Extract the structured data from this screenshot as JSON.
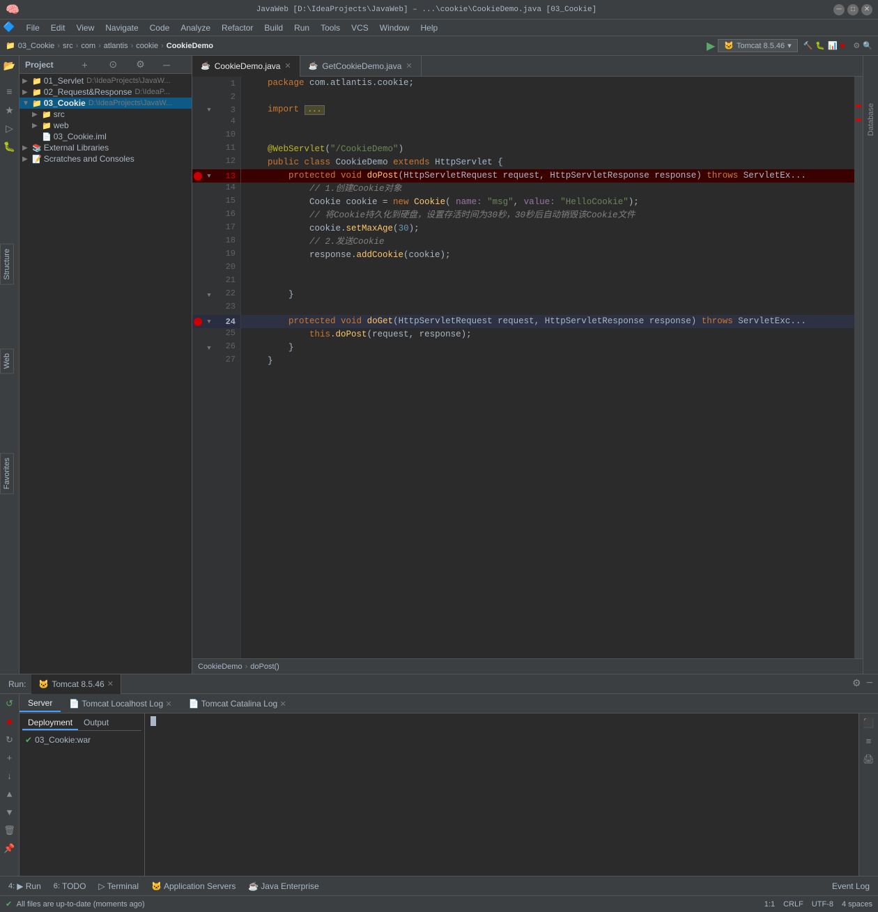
{
  "window": {
    "title": "JavaWeb [D:\\IdeaProjects\\JavaWeb] – ...\\cookie\\CookieDemo.java [03_Cookie]",
    "os_icon": "intellij-icon"
  },
  "menu": {
    "items": [
      "File",
      "Edit",
      "View",
      "Navigate",
      "Code",
      "Analyze",
      "Refactor",
      "Build",
      "Run",
      "Tools",
      "VCS",
      "Window",
      "Help"
    ]
  },
  "breadcrumb": {
    "items": [
      "03_Cookie",
      "src",
      "com",
      "atlantis",
      "cookie",
      "CookieDemo"
    ],
    "run_config": "Tomcat 8.5.46"
  },
  "project": {
    "label": "Project",
    "items": [
      {
        "indent": 0,
        "type": "folder",
        "name": "01_Servlet",
        "path": "D:\\IdeaProjects\\JavaW...",
        "expanded": true
      },
      {
        "indent": 0,
        "type": "folder",
        "name": "02_Request&Response",
        "path": "D:\\IdeaP...",
        "expanded": false
      },
      {
        "indent": 0,
        "type": "folder",
        "name": "03_Cookie",
        "path": "D:\\IdeaProjects\\JavaW...",
        "expanded": true,
        "selected": true
      },
      {
        "indent": 1,
        "type": "folder",
        "name": "src",
        "expanded": true
      },
      {
        "indent": 1,
        "type": "folder",
        "name": "web",
        "expanded": false
      },
      {
        "indent": 1,
        "type": "xml",
        "name": "03_Cookie.iml",
        "expanded": false
      },
      {
        "indent": 0,
        "type": "lib",
        "name": "External Libraries",
        "expanded": false
      },
      {
        "indent": 0,
        "type": "scratch",
        "name": "Scratches and Consoles",
        "expanded": false
      }
    ]
  },
  "tabs": [
    {
      "label": "CookieDemo.java",
      "active": true
    },
    {
      "label": "GetCookieDemo.java",
      "active": false
    }
  ],
  "code": {
    "lines": [
      {
        "num": 1,
        "content": "    package com.atlantis.cookie;",
        "type": "package"
      },
      {
        "num": 2,
        "content": ""
      },
      {
        "num": 3,
        "content": "    import ...",
        "type": "import",
        "has_fold": true
      },
      {
        "num": 4,
        "content": ""
      },
      {
        "num": 10,
        "content": ""
      },
      {
        "num": 11,
        "content": "    @WebServlet(\"/CookieDemo\")",
        "type": "annotation"
      },
      {
        "num": 12,
        "content": "    public class CookieDemo extends HttpServlet {",
        "type": "class"
      },
      {
        "num": 13,
        "content": "        protected void doPost(HttpServletRequest request, HttpServletResponse response) throws ServletEx...",
        "type": "method",
        "has_bp": true,
        "has_fold": true
      },
      {
        "num": 14,
        "content": "            // 1.创建Cookie对象",
        "type": "comment"
      },
      {
        "num": 15,
        "content": "            Cookie cookie = new Cookie( name: \"msg\", value: \"HelloCookie\");",
        "type": "code"
      },
      {
        "num": 16,
        "content": "            // 将Cookie持久化到硬盘，设置存活时间为30秒，30秒后自动销毁该Cookie文件",
        "type": "comment"
      },
      {
        "num": 17,
        "content": "            cookie.setMaxAge(30);",
        "type": "code"
      },
      {
        "num": 18,
        "content": "            // 2.发送Cookie",
        "type": "comment"
      },
      {
        "num": 19,
        "content": "            response.addCookie(cookie);",
        "type": "code"
      },
      {
        "num": 20,
        "content": ""
      },
      {
        "num": 21,
        "content": ""
      },
      {
        "num": 22,
        "content": "        }",
        "has_fold": true
      },
      {
        "num": 23,
        "content": ""
      },
      {
        "num": 24,
        "content": "        protected void doGet(HttpServletRequest request, HttpServletResponse response) throws ServletExc...",
        "type": "method",
        "has_bp": true,
        "has_fold": true,
        "is_active": true
      },
      {
        "num": 25,
        "content": "            this.doPost(request, response);",
        "type": "code"
      },
      {
        "num": 26,
        "content": "        }",
        "has_fold": true
      },
      {
        "num": 27,
        "content": "    }"
      }
    ]
  },
  "bottom_breadcrumb": {
    "items": [
      "CookieDemo",
      "doPost()"
    ]
  },
  "run_panel": {
    "label": "Run:",
    "config_name": "Tomcat 8.5.46",
    "tabs": [
      {
        "label": "Server",
        "active": false
      },
      {
        "label": "Tomcat Localhost Log",
        "active": false
      },
      {
        "label": "Tomcat Catalina Log",
        "active": false
      }
    ],
    "sub_tabs": [
      {
        "label": "Deployment",
        "active": true
      },
      {
        "label": "Output",
        "active": false
      }
    ],
    "deployment_items": [
      {
        "name": "03_Cookie:war",
        "status": "ok"
      }
    ]
  },
  "status_bar": {
    "message": "All files are up-to-date (moments ago)",
    "position": "1:1",
    "encoding": "CRLF",
    "charset": "UTF-8",
    "indent": "4 spaces"
  },
  "bottom_tools": [
    {
      "num": "4",
      "label": "Run"
    },
    {
      "num": "6",
      "label": "TODO"
    },
    {
      "label": "Terminal"
    },
    {
      "label": "Application Servers"
    },
    {
      "label": "Java Enterprise"
    }
  ],
  "database_label": "Database",
  "structure_label": "Structure",
  "web_label": "Web",
  "favorites_label": "Favorites",
  "event_log_label": "Event Log"
}
